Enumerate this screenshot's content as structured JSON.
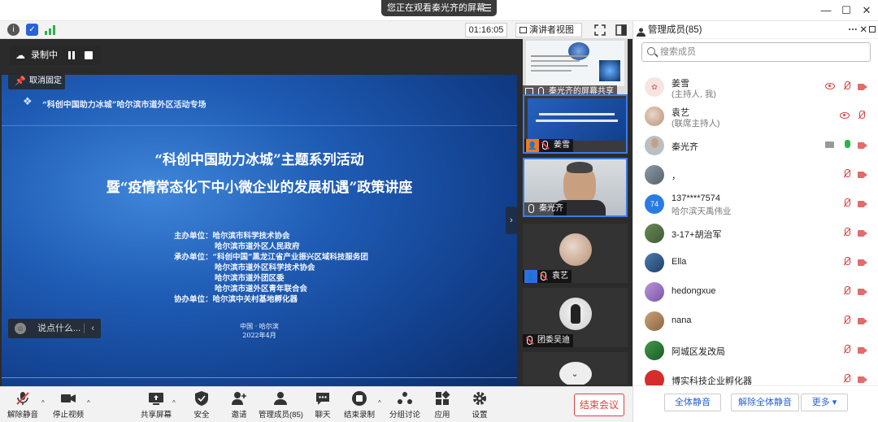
{
  "top": {
    "banner_text": "您正在观看秦光齐的屏幕",
    "banner_menu": "☰",
    "win_min": "—",
    "win_max": "☐",
    "win_close": "✕"
  },
  "meeting_bar": {
    "timer": "01:16:05",
    "view_label": "演讲者视图"
  },
  "stage": {
    "recording_label": "录制中",
    "unpin_label": "取消固定",
    "chat_placeholder": "说点什么...",
    "slide": {
      "header": "“科创中国助力冰城”哈尔滨市道外区活动专场",
      "title_1": "“科创中国助力冰城”主题系列活动",
      "title_2": "暨“疫情常态化下中小微企业的发展机遇”政策讲座",
      "organizers": [
        "主办单位：哈尔滨市科学技术协会",
        "哈尔滨市道外区人民政府",
        "承办单位：“科创中国”黑龙江省产业振兴区域科技服务团",
        "哈尔滨市道外区科学技术协会",
        "哈尔滨市道外团区委",
        "哈尔滨市道外区青年联合会",
        "协办单位：哈尔滨中关村基地孵化器"
      ],
      "footer_1": "中国 · 哈尔滨",
      "footer_2": "2022年4月"
    }
  },
  "thumbnails": [
    {
      "label": "秦光齐的屏幕共享"
    },
    {
      "label": "姜雪"
    },
    {
      "label": "秦光齐"
    },
    {
      "label": "袁艺"
    },
    {
      "label": "团委吴迪"
    }
  ],
  "toolbar": {
    "unmute": "解除静音",
    "stop_video": "停止视频",
    "share_screen": "共享屏幕",
    "security": "安全",
    "invite": "邀请",
    "members": "管理成员(85)",
    "chat": "聊天",
    "end_recording": "结束录制",
    "breakout": "分组讨论",
    "apps": "应用",
    "settings": "设置",
    "end_meeting": "结束会议"
  },
  "panel": {
    "title": "管理成员(85)",
    "more": "···",
    "close": "✕",
    "search_placeholder": "搜索成员",
    "members": [
      {
        "name": "姜雪",
        "role": "(主持人, 我)"
      },
      {
        "name": "袁艺",
        "role": "(联席主持人)"
      },
      {
        "name": "秦光齐",
        "role": ""
      },
      {
        "name": "，",
        "role": ""
      },
      {
        "name": "137****7574",
        "role": "哈尔滨天禹伟业",
        "avatar_text": "74"
      },
      {
        "name": "3-17+胡治军",
        "role": ""
      },
      {
        "name": "Ella",
        "role": ""
      },
      {
        "name": "hedongxue",
        "role": ""
      },
      {
        "name": "nana",
        "role": ""
      },
      {
        "name": "阿城区发改局",
        "role": ""
      },
      {
        "name": "博实科技企业孵化器",
        "role": ""
      }
    ],
    "mute_all": "全体静音",
    "unmute_all": "解除全体静音",
    "more_btn": "更多 ▾"
  },
  "colors": {
    "accent_blue": "#2a62d8",
    "danger_red": "#e04040",
    "mic_on_green": "#2bb24c"
  }
}
